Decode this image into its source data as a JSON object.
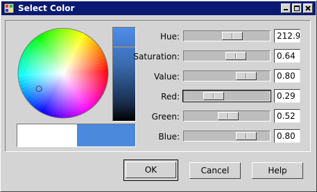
{
  "window": {
    "title": "Select Color",
    "icon": "palette-icon"
  },
  "titlebar_buttons": [
    "minimize-icon",
    "maximize-icon",
    "close-icon"
  ],
  "colors": {
    "current": "#4a89dc",
    "previous": "#ffffff",
    "title_bar": "#0a1a74"
  },
  "value_level": 0.8,
  "rows": [
    {
      "label": "Hue:",
      "value": "212.94",
      "level": 0.59
    },
    {
      "label": "Saturation:",
      "value": "0.64",
      "level": 0.64
    },
    {
      "label": "Value:",
      "value": "0.80",
      "level": 0.8
    },
    {
      "label": "Red:",
      "value": "0.29",
      "level": 0.29
    },
    {
      "label": "Green:",
      "value": "0.52",
      "level": 0.52
    },
    {
      "label": "Blue:",
      "value": "0.80",
      "level": 0.8
    }
  ],
  "buttons": {
    "ok": "OK",
    "cancel": "Cancel",
    "help": "Help"
  }
}
